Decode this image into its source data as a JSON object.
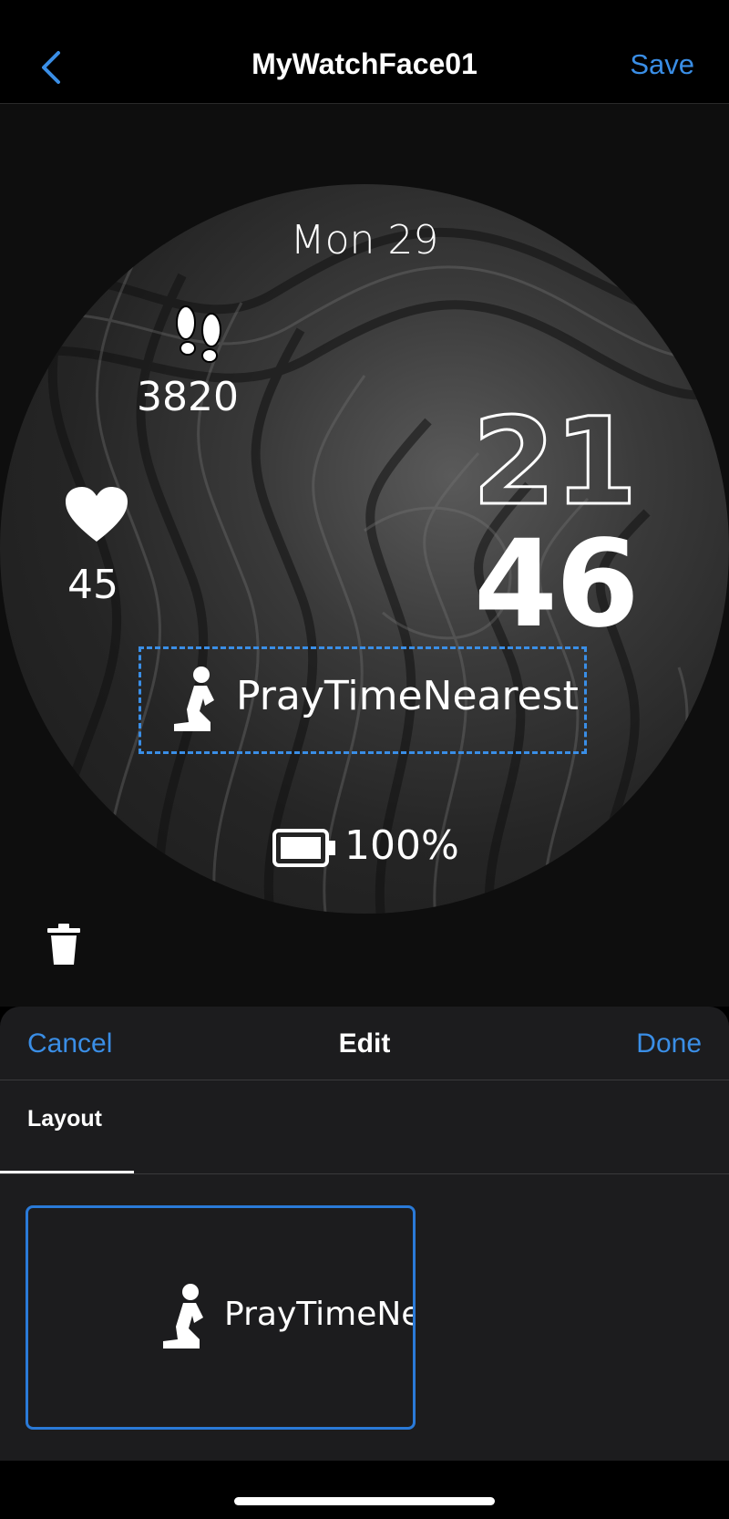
{
  "header": {
    "back_icon": "chevron-left-icon",
    "title": "MyWatchFace01",
    "save_label": "Save"
  },
  "watch": {
    "date": "Mon 29",
    "steps_icon": "footsteps-icon",
    "steps": "3820",
    "heart_icon": "heart-icon",
    "heart_rate": "45",
    "hour": "21",
    "minute": "46",
    "pray_icon": "praying-person-icon",
    "pray_label": "PrayTimeNearest",
    "battery_icon": "battery-icon",
    "battery": "100%"
  },
  "trash_icon": "trash-icon",
  "sheet": {
    "cancel_label": "Cancel",
    "title": "Edit",
    "done_label": "Done",
    "tab_label": "Layout",
    "option_text": "PrayTimeNe"
  },
  "colors": {
    "accent": "#3a8ee6",
    "sheet_bg": "#1c1c1e",
    "selection": "#2a7ad8"
  }
}
